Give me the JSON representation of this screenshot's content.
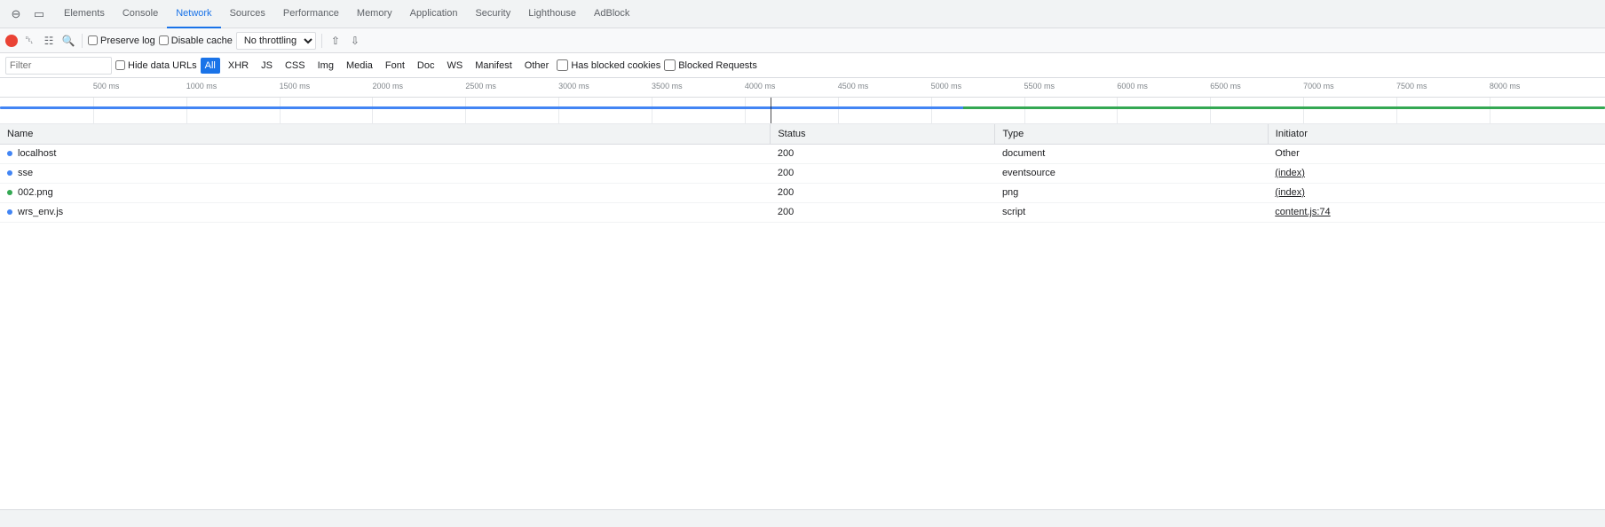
{
  "tabs": {
    "items": [
      {
        "label": "Elements",
        "active": false
      },
      {
        "label": "Console",
        "active": false
      },
      {
        "label": "Network",
        "active": true
      },
      {
        "label": "Sources",
        "active": false
      },
      {
        "label": "Performance",
        "active": false
      },
      {
        "label": "Memory",
        "active": false
      },
      {
        "label": "Application",
        "active": false
      },
      {
        "label": "Security",
        "active": false
      },
      {
        "label": "Lighthouse",
        "active": false
      },
      {
        "label": "AdBlock",
        "active": false
      }
    ]
  },
  "toolbar": {
    "preserve_log_label": "Preserve log",
    "disable_cache_label": "Disable cache",
    "throttle_value": "No throttling"
  },
  "filter": {
    "placeholder": "Filter",
    "hide_data_urls_label": "Hide data URLs",
    "filter_types": [
      "All",
      "XHR",
      "JS",
      "CSS",
      "Img",
      "Media",
      "Font",
      "Doc",
      "WS",
      "Manifest",
      "Other"
    ],
    "active_filter": "All",
    "has_blocked_cookies_label": "Has blocked cookies",
    "blocked_requests_label": "Blocked Requests"
  },
  "timeline": {
    "ticks": [
      {
        "label": "500 ms",
        "left_pct": 5.8
      },
      {
        "label": "1000 ms",
        "left_pct": 11.6
      },
      {
        "label": "1500 ms",
        "left_pct": 17.4
      },
      {
        "label": "2000 ms",
        "left_pct": 23.2
      },
      {
        "label": "2500 ms",
        "left_pct": 29
      },
      {
        "label": "3000 ms",
        "left_pct": 34.8
      },
      {
        "label": "3500 ms",
        "left_pct": 40.6
      },
      {
        "label": "4000 ms",
        "left_pct": 46.4
      },
      {
        "label": "4500 ms",
        "left_pct": 52.2
      },
      {
        "label": "5000 ms",
        "left_pct": 58
      },
      {
        "label": "5500 ms",
        "left_pct": 63.8
      },
      {
        "label": "6000 ms",
        "left_pct": 69.6
      },
      {
        "label": "6500 ms",
        "left_pct": 75.4
      },
      {
        "label": "7000 ms",
        "left_pct": 81.2
      },
      {
        "label": "7500 ms",
        "left_pct": 87
      },
      {
        "label": "8000 ms",
        "left_pct": 92.8
      }
    ]
  },
  "table": {
    "headers": [
      "Name",
      "Status",
      "Type",
      "Initiator"
    ],
    "rows": [
      {
        "name": "localhost",
        "status": "200",
        "type": "document",
        "initiator": "Other",
        "initiator_link": false,
        "color": "blue"
      },
      {
        "name": "sse",
        "status": "200",
        "type": "eventsource",
        "initiator": "(index)",
        "initiator_link": true,
        "color": "blue"
      },
      {
        "name": "002.png",
        "status": "200",
        "type": "png",
        "initiator": "(index)",
        "initiator_link": true,
        "color": "green"
      },
      {
        "name": "wrs_env.js",
        "status": "200",
        "type": "script",
        "initiator": "content.js:74",
        "initiator_link": true,
        "color": "blue"
      }
    ]
  },
  "status_bar": {
    "text": ""
  }
}
